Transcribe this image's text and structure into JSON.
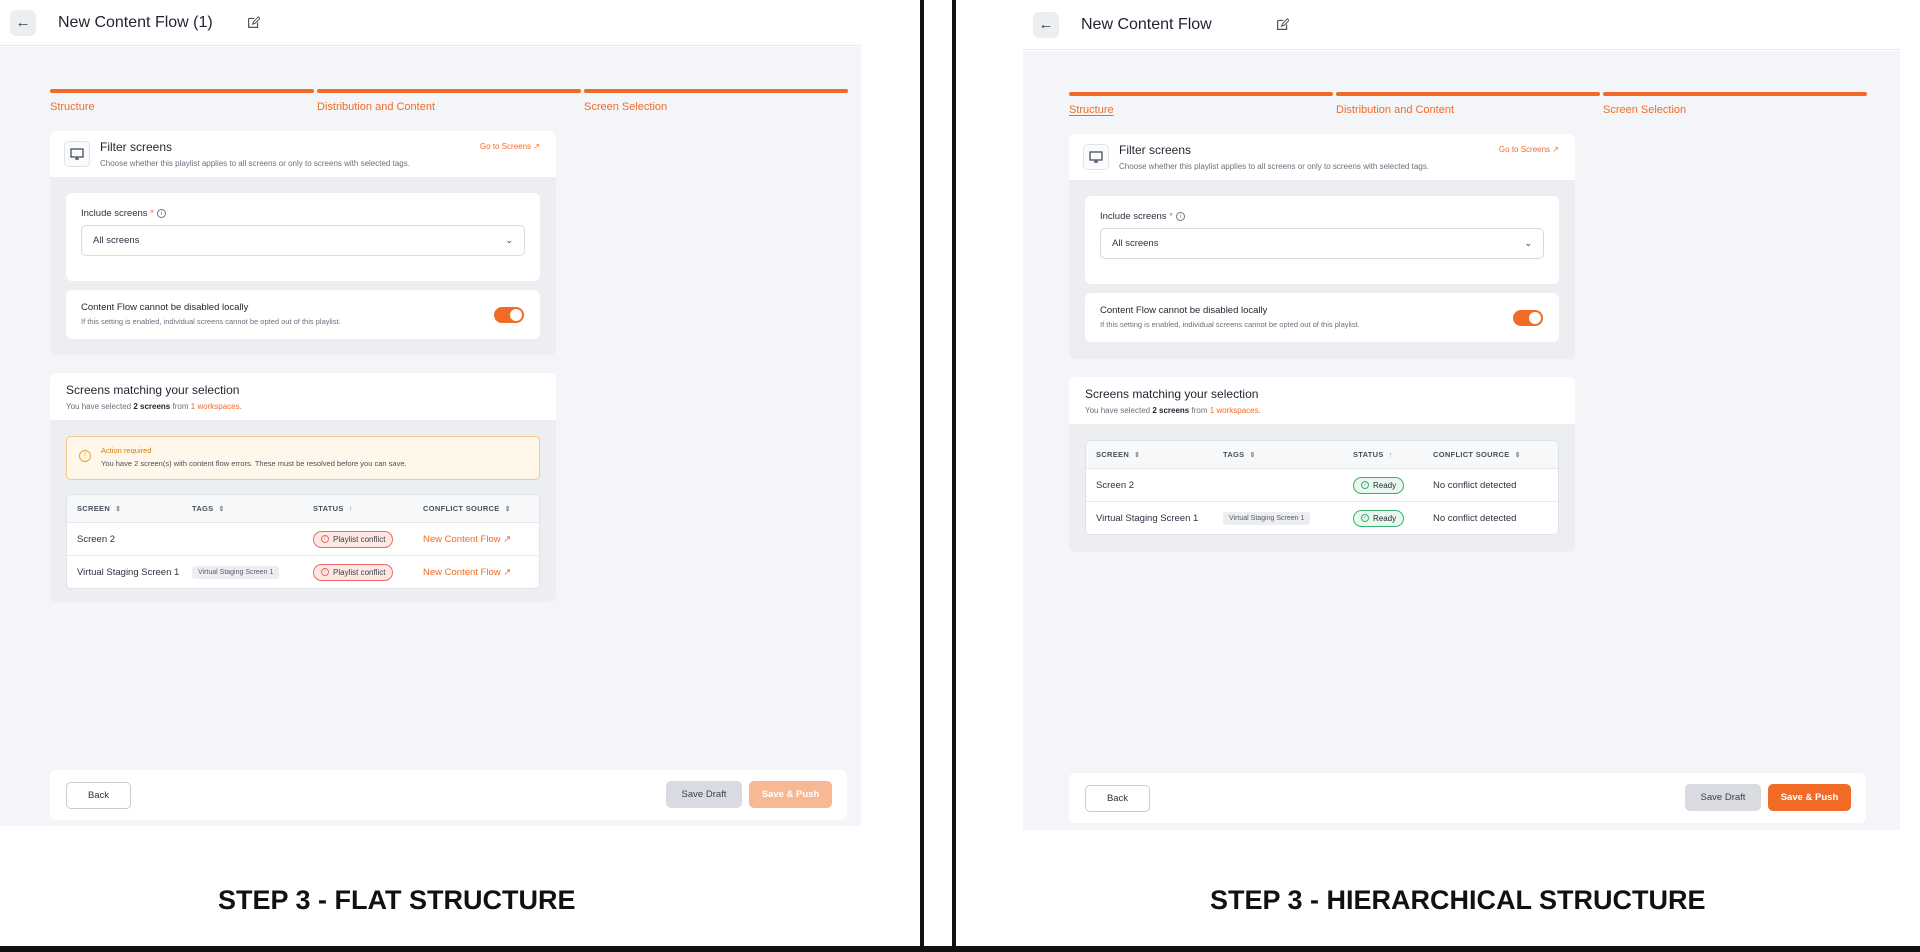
{
  "left": {
    "title": "New Content Flow (1)",
    "steps": [
      "Structure",
      "Distribution and Content",
      "Screen Selection"
    ],
    "filter": {
      "title": "Filter screens",
      "subtitle": "Choose whether this playlist applies to all screens or only to screens with selected tags.",
      "goto": "Go to Screens"
    },
    "include": {
      "label": "Include screens",
      "required": "*",
      "value": "All screens"
    },
    "toggle": {
      "title": "Content Flow cannot be disabled locally",
      "subtitle": "If this setting is enabled, individual screens cannot be opted out of this playlist.",
      "on": true
    },
    "matching": {
      "title": "Screens matching your selection",
      "pre": "You have selected",
      "count": "2 screens",
      "mid": "from",
      "workspaces": "1 workspaces",
      "post": "."
    },
    "alert": {
      "title": "Action required",
      "text": "You have 2 screen(s) with content flow errors. These must be resolved before you can save."
    },
    "table": {
      "headers": [
        "SCREEN",
        "TAGS",
        "STATUS",
        "CONFLICT SOURCE"
      ],
      "rows": [
        {
          "screen": "Screen 2",
          "tag": "",
          "status": "Playlist conflict",
          "conflict": "New Content Flow"
        },
        {
          "screen": "Virtual Staging Screen 1",
          "tag": "Virtual Staging Screen 1",
          "status": "Playlist conflict",
          "conflict": "New Content Flow"
        }
      ]
    },
    "footer": {
      "back": "Back",
      "draft": "Save Draft",
      "push": "Save & Push",
      "push_color": "#f8b894"
    }
  },
  "right": {
    "title": "New Content Flow",
    "steps": [
      "Structure",
      "Distribution and Content",
      "Screen Selection"
    ],
    "filter": {
      "title": "Filter screens",
      "subtitle": "Choose whether this playlist applies to all screens or only to screens with selected tags.",
      "goto": "Go to Screens"
    },
    "include": {
      "label": "Include screens",
      "required": "*",
      "value": "All screens"
    },
    "toggle": {
      "title": "Content Flow cannot be disabled locally",
      "subtitle": "If this setting is enabled, individual screens cannot be opted out of this playlist.",
      "on": true
    },
    "matching": {
      "title": "Screens matching your selection",
      "pre": "You have selected",
      "count": "2 screens",
      "mid": "from",
      "workspaces": "1 workspaces",
      "post": "."
    },
    "table": {
      "headers": [
        "SCREEN",
        "TAGS",
        "STATUS",
        "CONFLICT SOURCE"
      ],
      "rows": [
        {
          "screen": "Screen 2",
          "tag": "",
          "status": "Ready",
          "conflict": "No conflict detected"
        },
        {
          "screen": "Virtual Staging Screen 1",
          "tag": "Virtual Staging Screen 1",
          "status": "Ready",
          "conflict": "No conflict detected"
        }
      ]
    },
    "footer": {
      "back": "Back",
      "draft": "Save Draft",
      "push": "Save & Push",
      "push_color": "#f26b26"
    }
  },
  "captions": {
    "left": "STEP 3 - FLAT STRUCTURE",
    "right": "STEP 3 - HIERARCHICAL STRUCTURE"
  },
  "colors": {
    "accent": "#f26b26",
    "ready": "#34b36e",
    "conflict": "#e96a6a",
    "warning": "#e9a23b"
  }
}
